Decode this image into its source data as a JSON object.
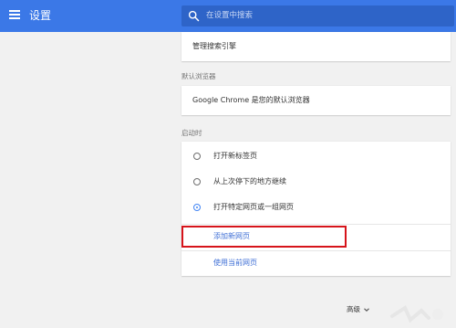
{
  "header": {
    "title": "设置",
    "search_placeholder": "在设置中搜索",
    "bar_color": "#3b78e7",
    "icons": [
      "menu-icon",
      "search-icon"
    ]
  },
  "search_engine": {
    "manage_label": "管理搜索引擎"
  },
  "default_browser": {
    "section_label": "默认浏览器",
    "status_text": "Google Chrome 是您的默认浏览器"
  },
  "on_startup": {
    "section_label": "启动时",
    "options": [
      {
        "label": "打开新标签页",
        "selected": false
      },
      {
        "label": "从上次停下的地方继续",
        "selected": false
      },
      {
        "label": "打开特定网页或一组网页",
        "selected": true
      }
    ],
    "add_page_label": "添加新网页",
    "use_current_label": "使用当前网页"
  },
  "advanced": {
    "label": "高级"
  },
  "colors": {
    "accent": "#4285f4",
    "link": "#3f6fd6",
    "highlight_box": "#d6141b"
  }
}
